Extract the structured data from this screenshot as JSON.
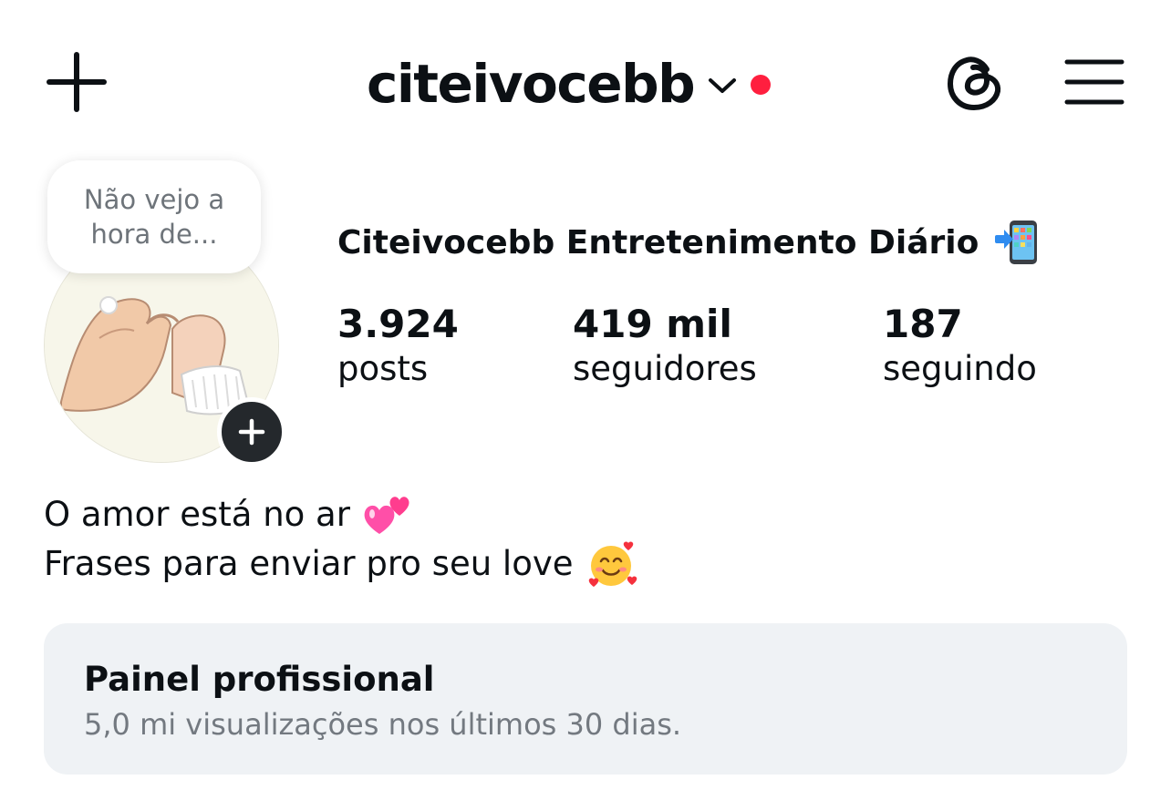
{
  "header": {
    "username": "citeivocebb",
    "create_icon": "plus-icon",
    "threads_icon": "threads-icon",
    "menu_icon": "hamburger-menu-icon",
    "notification_dot_color": "#ff1f3f"
  },
  "profile": {
    "note": "Não vejo a hora de...",
    "display_name": "Citeivocebb Entretenimento Diário",
    "display_name_emoji": "mobile-phone-arrow-emoji",
    "avatar_add_icon": "plus-icon",
    "stats": [
      {
        "value": "3.924",
        "label": "posts"
      },
      {
        "value": "419 mil",
        "label": "seguidores"
      },
      {
        "value": "187",
        "label": "seguindo"
      }
    ]
  },
  "bio": {
    "line1": "O amor está no ar",
    "line1_emoji": "two-hearts-emoji",
    "line2": "Frases para enviar pro seu love",
    "line2_emoji": "smiling-face-with-hearts-emoji"
  },
  "professional_dashboard": {
    "title": "Painel profissional",
    "subtitle": "5,0 mi visualizações nos últimos 30 dias."
  },
  "colors": {
    "text": "#0c1014",
    "muted": "#737980",
    "panel_bg": "#eff2f5",
    "accent_red": "#ff1f3f"
  }
}
